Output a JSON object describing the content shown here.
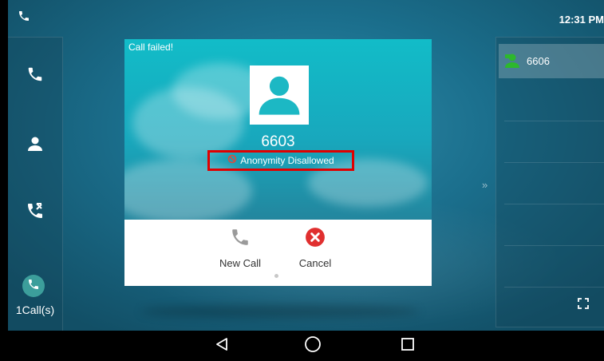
{
  "status_bar": {
    "time": "12:31 PM"
  },
  "sidebar": {
    "calls_count_label": "1Call(s)"
  },
  "dialog": {
    "title": "Call failed!",
    "number": "6603",
    "reason": "Anonymity Disallowed",
    "actions": {
      "new_call": "New Call",
      "cancel": "Cancel"
    }
  },
  "line_panel": {
    "account_label": "6606"
  },
  "colors": {
    "accent_teal": "#1bb9c6",
    "cancel_red": "#e02f2f",
    "highlight_red": "#e00000",
    "account_green": "#2db82d"
  }
}
